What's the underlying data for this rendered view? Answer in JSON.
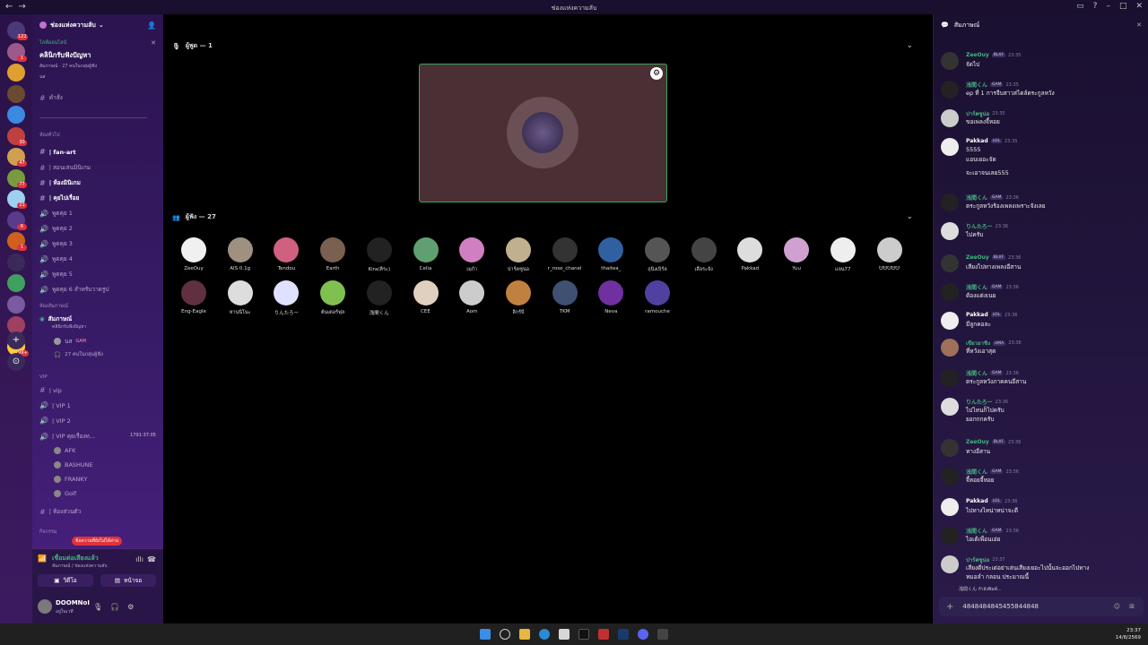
{
  "titlebar": {
    "title": "ช่องแห่งความลับ",
    "back": "←",
    "fwd": "→"
  },
  "guild_badges": [
    "122",
    "1",
    "",
    "",
    "",
    "30",
    "47",
    "77",
    "21",
    "6",
    "1",
    "",
    "",
    "",
    "",
    "99+"
  ],
  "server": {
    "name": "ช่องแห่งความลับ",
    "event_label": "ไลฟ์ออนไลน์",
    "event_title": "คลินิกรับฟังปัญหา",
    "event_sub": "สัมภาษณ์ · 27 คนในกลุ่มผู้ฟัง",
    "event_user": "นส"
  },
  "channels": {
    "commands": "คำสั่ง",
    "cat_general": "ห้องทั่วไป",
    "list": [
      "| fan-art",
      "| สอนเล่นมินิเกม",
      "| ห้องมินิเกม",
      "| คุยไปเรื่อย",
      "พูดคุย 1",
      "พูดคุย 2",
      "พูดคุย 3",
      "พูดคุย 4",
      "พูดคุย 5",
      "พูดคุย 6 สำหรับวาดรูป"
    ],
    "cat_interview": "ห้องสัมภาษณ์",
    "stage": "สัมภาษณ์",
    "stage_sub": "คลินิกรับฟังปัญหา",
    "stage_user": "นส",
    "stage_user_tag": "GAM",
    "stage_listen": "27 คนในกลุ่มผู้ฟัง",
    "cat_vip": "VIP",
    "vip": [
      "| vip",
      "| VIP 1",
      "| VIP 2",
      "| VIP คุยเรื่องท..."
    ],
    "vip_timer": "1791:37:05",
    "vip_users": [
      "AFK",
      "BASHUNE",
      "FRANKY",
      "Golf"
    ],
    "private": "| ห้องส่วนตัว",
    "cat_private": "กิจกรรม",
    "new_msg": "ข้อความที่ยังไม่ได้อ่าน"
  },
  "voice": {
    "status": "เชื่อมต่อเสียงแล้ว",
    "location": "สัมภาษณ์ / ช่องแห่งความลับ",
    "video": "วิดีโอ",
    "screen": "หน้าจอ"
  },
  "user": {
    "name": "DOOMNoI",
    "status": "อยู่ในเวที"
  },
  "stage": {
    "speakers_label": "ผู้พูด — 1",
    "listeners_label": "ผู้ฟัง — 27"
  },
  "audience": [
    "ZeeOuy",
    "AIS 0.1g",
    "Tendou",
    "Earth",
    "Kira(คิระ)",
    "Celia",
    "เมก้า",
    "ปาร์คซูน่อ",
    "r_rose_chanel",
    "thaitea_",
    "ถุนิงเบิร์ล",
    "เสือระจัง",
    "Pakkad",
    "Yuu",
    "แจน77",
    "ᗢᗢᗢᗢᗢ",
    "Eng-Eagle",
    "หานนิโนะ",
    "りんたろー",
    "ต้นเตอร์ฟุล",
    "浅間くん",
    "CEE",
    "Aom",
    "ลีกร์บี",
    "TKM",
    "Neva",
    "ramouche"
  ],
  "chat": {
    "title": "สัมภาษณ์",
    "input_value": "4848484845455844848",
    "messages": [
      {
        "name": "ZeeOuy",
        "tag": "BLXF",
        "time": "23:35",
        "text": "จัดไป",
        "text2": "",
        "color": "#43b581"
      },
      {
        "name": "浅間くん",
        "tag": "GAM",
        "time": "23:35",
        "text": "ep ที่ 1 การจีบสาวสไตล์ตระกูลหวัง",
        "text2": "",
        "color": "#43b581"
      },
      {
        "name": "ปาร์คซูน่อ",
        "tag": "",
        "time": "23:35",
        "text": "ขอเพลงจี้หอย",
        "text2": "",
        "color": "#43b581"
      },
      {
        "name": "Pakkad",
        "tag": "LOL",
        "time": "23:35",
        "text": "5555",
        "text2": "แอบเยอะจัด",
        "color": "#fff"
      },
      {
        "name": "",
        "tag": "",
        "time": "",
        "text": "จะเอาจนเลย555",
        "text2": "",
        "color": "#fff"
      },
      {
        "name": "浅間くん",
        "tag": "GAM",
        "time": "23:36",
        "text": "ตระกูลหวังร้องเพลงเพราะจังเลย",
        "text2": "",
        "color": "#43b581"
      },
      {
        "name": "りんたろー",
        "tag": "",
        "time": "23:36",
        "text": "ไปครับ",
        "text2": "",
        "color": "#43b581"
      },
      {
        "name": "ZeeOuy",
        "tag": "BLXF",
        "time": "23:36",
        "text": "เสียงไปทางเพลงอีสาน",
        "text2": "",
        "color": "#43b581"
      },
      {
        "name": "浅間くん",
        "tag": "GAM",
        "time": "23:36",
        "text": "ต้องแต่งเนย",
        "text2": "",
        "color": "#43b581"
      },
      {
        "name": "Pakkad",
        "tag": "LOL",
        "time": "23:36",
        "text": "มีลูกคอละ",
        "text2": "",
        "color": "#fff"
      },
      {
        "name": "เขียวอาชิง",
        "tag": "UMA",
        "time": "23:36",
        "text": "ที่หวังเอาสุด",
        "text2": "",
        "color": "#43b581"
      },
      {
        "name": "浅間くん",
        "tag": "GAM",
        "time": "23:36",
        "text": "ตระกูลหวังภาคคนอีสาน",
        "text2": "",
        "color": "#43b581"
      },
      {
        "name": "りんたろー",
        "tag": "",
        "time": "23:36",
        "text": "ไปไหนก็ไปครับ",
        "text2": "ยอกกกครับ",
        "color": "#43b581"
      },
      {
        "name": "ZeeOuy",
        "tag": "BLXF",
        "time": "23:36",
        "text": "ทางอีสาน",
        "text2": "",
        "color": "#43b581"
      },
      {
        "name": "浅間くん",
        "tag": "GAM",
        "time": "23:36",
        "text": "จี้หอยจี้หอย",
        "text2": "",
        "color": "#43b581"
      },
      {
        "name": "Pakkad",
        "tag": "LOL",
        "time": "23:36",
        "text": "ไปทางไหน่าหน่าจะดี",
        "text2": "",
        "color": "#fff"
      },
      {
        "name": "浅間くん",
        "tag": "GAM",
        "time": "23:36",
        "text": "ไอเด้เพื่อนเอ่ย",
        "text2": "",
        "color": "#43b581"
      },
      {
        "name": "ปาร์คซูน่อ",
        "tag": "",
        "time": "23:37",
        "text": "เสียงดีประเด่อย่าเล่นเสียงเยอะไปนั้นจะออกไปทาง",
        "text2": "หมอลำ กลอน ประมาณนี้",
        "color": "#43b581"
      }
    ],
    "typing": "浅間くん กำลังพิมพ์..."
  },
  "clock": {
    "time": "23:37",
    "date": "14/8/2569"
  }
}
